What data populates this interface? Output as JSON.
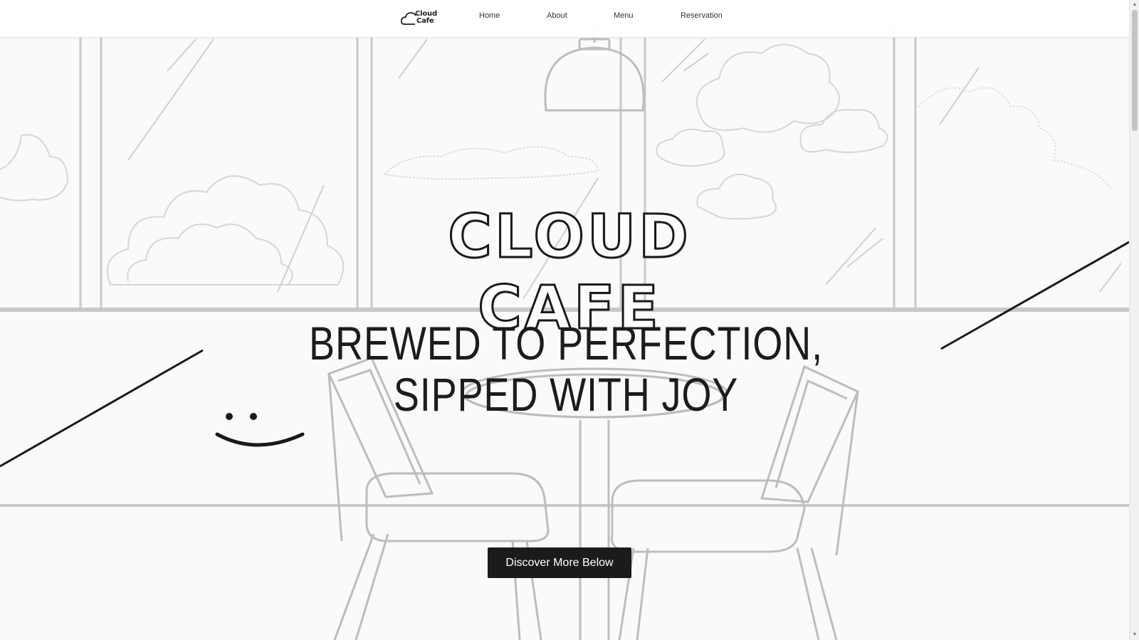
{
  "brand": {
    "logo_line1": "Cloud",
    "logo_line2": "Cafe"
  },
  "nav": {
    "home": "Home",
    "about": "About",
    "menu": "Menu",
    "reservation": "Reservation"
  },
  "hero": {
    "title": "CLOUD CAFE",
    "tagline": "BREWED TO PERFECTION, SIPPED WITH JOY",
    "cta_label": "Discover More Below"
  },
  "icons": {
    "logo": "cloud-icon",
    "smile": "smiley-face-icon",
    "scroll_up": "scroll-up-arrow-icon",
    "scroll_down": "scroll-down-arrow-icon"
  },
  "colors": {
    "background": "#fbfaf8",
    "ink": "#1b1b1b",
    "sketch_line": "#c9c9c9",
    "button_bg": "#1b1b1b",
    "button_text": "#ffffff"
  }
}
